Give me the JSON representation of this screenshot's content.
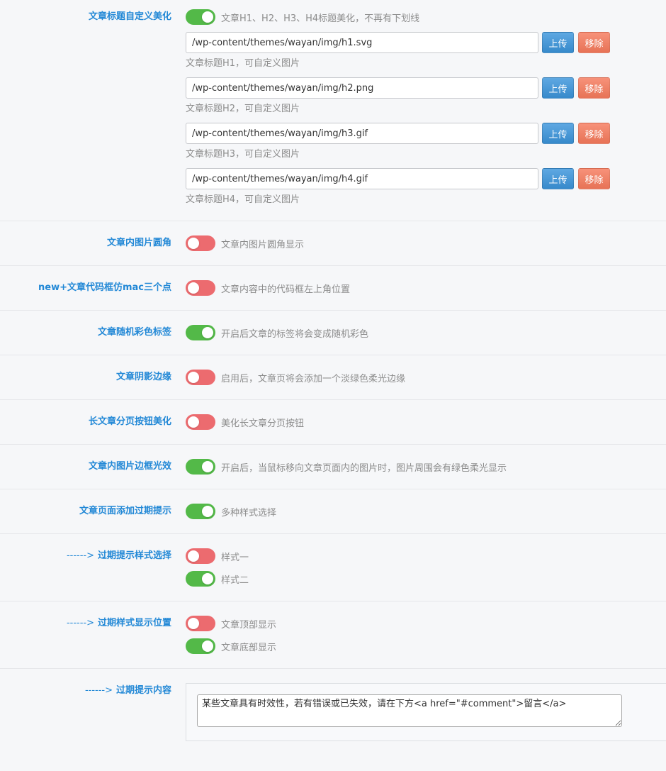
{
  "theme": {
    "label_color": "#2288d6",
    "toggle_on_color": "#53b948",
    "toggle_off_color": "#ec6b6f",
    "upload_button_color": "#3b95dc",
    "remove_button_color": "#f57a5c"
  },
  "image_buttons": {
    "upload": "上传",
    "remove": "移除"
  },
  "settings": [
    {
      "label": "文章标题自定义美化",
      "toggles": [
        {
          "on": true,
          "text": "文章H1、H2、H3、H4标题美化，不再有下划线"
        }
      ],
      "images": [
        {
          "value": "/wp-content/themes/wayan/img/h1.svg",
          "help": "文章标题H1，可自定义图片"
        },
        {
          "value": "/wp-content/themes/wayan/img/h2.png",
          "help": "文章标题H2，可自定义图片"
        },
        {
          "value": "/wp-content/themes/wayan/img/h3.gif",
          "help": "文章标题H3，可自定义图片"
        },
        {
          "value": "/wp-content/themes/wayan/img/h4.gif",
          "help": "文章标题H4，可自定义图片"
        }
      ]
    },
    {
      "label": "文章内图片圆角",
      "toggles": [
        {
          "on": false,
          "text": "文章内图片圆角显示"
        }
      ]
    },
    {
      "label": "new+文章代码框仿mac三个点",
      "toggles": [
        {
          "on": false,
          "text": "文章内容中的代码框左上角位置"
        }
      ]
    },
    {
      "label": "文章随机彩色标签",
      "toggles": [
        {
          "on": true,
          "text": "开启后文章的标签将会变成随机彩色"
        }
      ]
    },
    {
      "label": "文章阴影边缘",
      "toggles": [
        {
          "on": false,
          "text": "启用后，文章页将会添加一个淡绿色柔光边缘"
        }
      ]
    },
    {
      "label": "长文章分页按钮美化",
      "toggles": [
        {
          "on": false,
          "text": "美化长文章分页按钮"
        }
      ]
    },
    {
      "label": "文章内图片边框光效",
      "toggles": [
        {
          "on": true,
          "text": "开启后，当鼠标移向文章页面内的图片时，图片周围会有绿色柔光显示"
        }
      ]
    },
    {
      "label": "文章页面添加过期提示",
      "toggles": [
        {
          "on": true,
          "text": "多种样式选择"
        }
      ]
    },
    {
      "prefix": "------>",
      "label": "过期提示样式选择",
      "toggles": [
        {
          "on": false,
          "text": "样式一"
        },
        {
          "on": true,
          "text": "样式二"
        }
      ]
    },
    {
      "prefix": "------>",
      "label": "过期样式显示位置",
      "toggles": [
        {
          "on": false,
          "text": "文章顶部显示"
        },
        {
          "on": true,
          "text": "文章底部显示"
        }
      ]
    },
    {
      "prefix": "------>",
      "label": "过期提示内容",
      "textarea": "某些文章具有时效性，若有错误或已失效，请在下方<a href=\"#comment\">留言</a>"
    }
  ]
}
